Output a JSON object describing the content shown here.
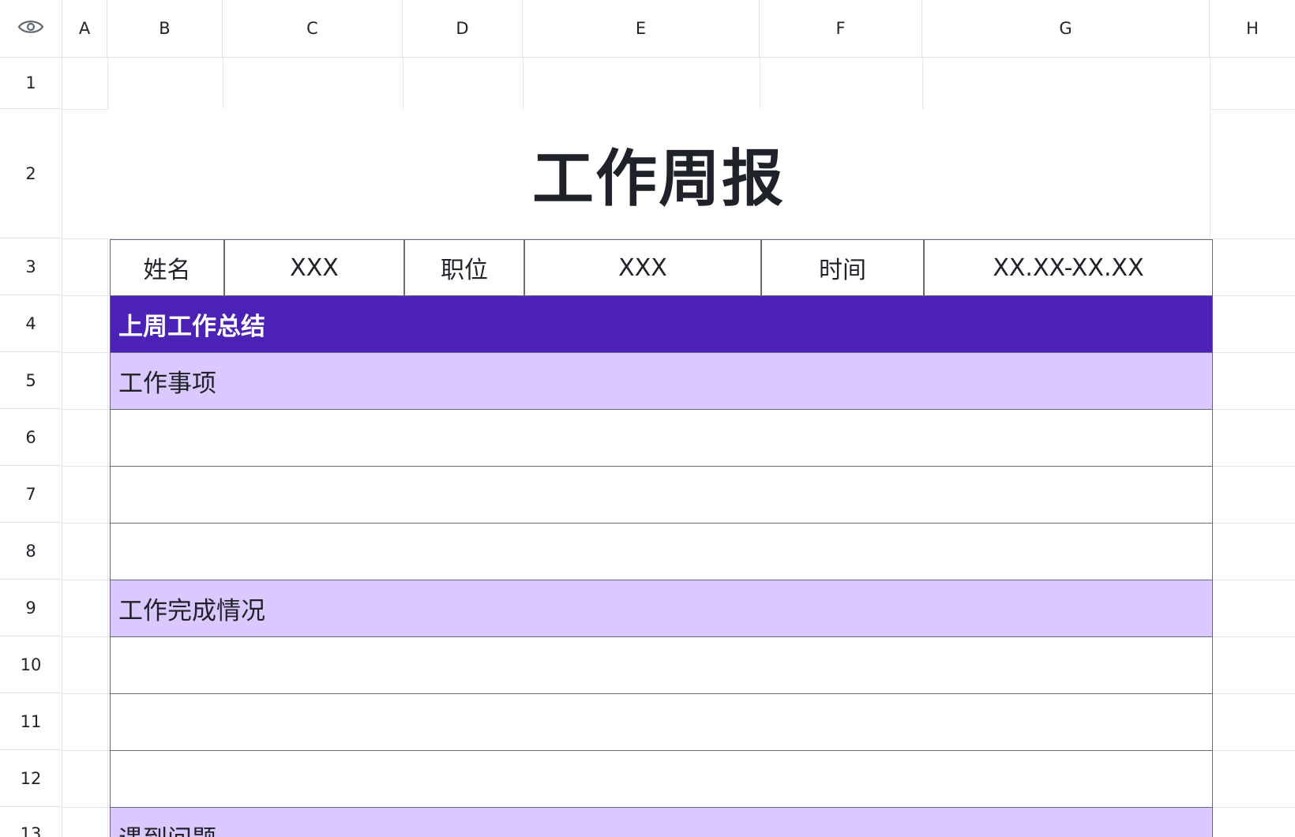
{
  "sheet": {
    "visibility_icon": "eye-icon",
    "columns": [
      "A",
      "B",
      "C",
      "D",
      "E",
      "F",
      "G",
      "H"
    ],
    "rows": [
      "1",
      "2",
      "3",
      "4",
      "5",
      "6",
      "7",
      "8",
      "9",
      "10",
      "11",
      "12",
      "13"
    ]
  },
  "report": {
    "title": "工作周报",
    "info": {
      "name_label": "姓名",
      "name_value": "XXX",
      "position_label": "职位",
      "position_value": "XXX",
      "time_label": "时间",
      "time_value": "XX.XX-XX.XX"
    },
    "section_last_week": "上周工作总结",
    "work_items": "工作事项",
    "work_completion": "工作完成情况",
    "problems": "遇到问题"
  },
  "colors": {
    "section_dark": "#4c21b5",
    "section_light": "#dac8ff",
    "border": "#646a73",
    "gridline": "#e4e6e9"
  }
}
